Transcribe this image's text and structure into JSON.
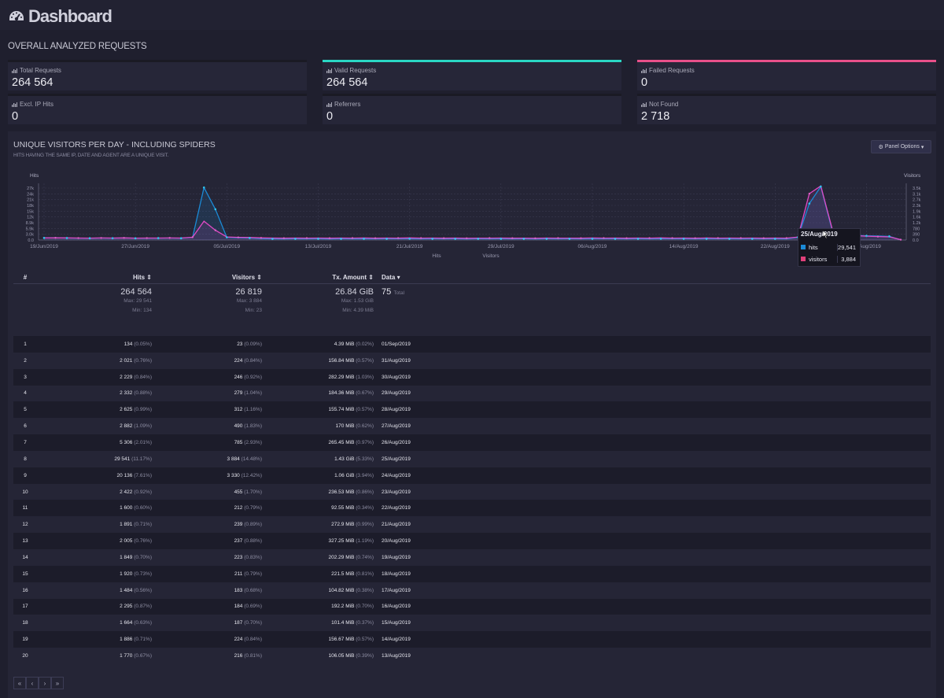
{
  "app": {
    "title": "Dashboard"
  },
  "overall": {
    "title": "OVERALL ANALYZED REQUESTS",
    "cards": [
      {
        "label": "Total Requests",
        "value": "264 564",
        "accent": "#1a1a24"
      },
      {
        "label": "Valid Requests",
        "value": "264 564",
        "accent": "#2ad7c4"
      },
      {
        "label": "Failed Requests",
        "value": "0",
        "accent": "#e8508a"
      },
      {
        "label": "Excl. IP Hits",
        "value": "0",
        "accent": "#1a1a24"
      },
      {
        "label": "Referrers",
        "value": "0",
        "accent": "#1a1a24"
      },
      {
        "label": "Not Found",
        "value": "2 718",
        "accent": "#1a1a24"
      }
    ]
  },
  "panel": {
    "title": "UNIQUE VISITORS PER DAY - INCLUDING SPIDERS",
    "subtitle": "HITS HAVING THE SAME IP, DATE AND AGENT ARE A UNIQUE VISIT.",
    "options_label": "Panel Options"
  },
  "chart_data": {
    "type": "area",
    "ylabel_left": "Hits",
    "ylabel_right": "Visitors",
    "y_ticks_left": [
      "27k",
      "24k",
      "21k",
      "18k",
      "15k",
      "12k",
      "8.9k",
      "5.9k",
      "3.0k",
      "0.0"
    ],
    "y_ticks_right": [
      "3.5k",
      "3.1k",
      "2.7k",
      "2.3k",
      "1.9k",
      "1.6k",
      "1.2k",
      "780",
      "390",
      "0.0"
    ],
    "x_ticks": [
      "19/Jun/2019",
      "27/Jun/2019",
      "05/Jul/2019",
      "13/Jul/2019",
      "21/Jul/2019",
      "29/Jul/2019",
      "06/Aug/2019",
      "14/Aug/2019",
      "22/Aug/2019",
      "30/Aug/2019"
    ],
    "legend": [
      "Hits",
      "Visitors"
    ],
    "colors": {
      "hits": "#1b8ad6",
      "visitors": "#e04ac4"
    },
    "series": [
      {
        "name": "Hits",
        "values": [
          1150,
          1200,
          1100,
          1050,
          1000,
          1080,
          1020,
          1120,
          980,
          1020,
          1050,
          1100,
          1000,
          1500,
          29000,
          17000,
          1500,
          1200,
          1100,
          800,
          650,
          600,
          700,
          650,
          700,
          620,
          700,
          650,
          720,
          640,
          700,
          680,
          760,
          650,
          700,
          640,
          700,
          620,
          680,
          660,
          700,
          640,
          680,
          600,
          700,
          660,
          680,
          640,
          720,
          680,
          700,
          640,
          700,
          660,
          760,
          680,
          700,
          650,
          720,
          680,
          700,
          660,
          700,
          640,
          700,
          650,
          1500,
          20136,
          29541,
          5306,
          2882,
          2625,
          2332,
          2229,
          2021,
          134
        ]
      },
      {
        "name": "Visitors",
        "values": [
          150,
          155,
          150,
          140,
          138,
          145,
          140,
          150,
          135,
          140,
          140,
          148,
          140,
          200,
          1350,
          700,
          220,
          190,
          180,
          150,
          140,
          130,
          140,
          135,
          140,
          128,
          140,
          135,
          145,
          130,
          140,
          138,
          150,
          135,
          140,
          128,
          140,
          125,
          138,
          135,
          140,
          130,
          138,
          122,
          140,
          135,
          138,
          130,
          145,
          138,
          140,
          130,
          140,
          135,
          150,
          138,
          140,
          132,
          145,
          138,
          140,
          135,
          140,
          130,
          140,
          135,
          211,
          3330,
          3884,
          785,
          490,
          312,
          279,
          246,
          224,
          23
        ]
      }
    ],
    "tooltip": {
      "date": "25/Aug/2019",
      "hits_label": "hits",
      "hits_value": "29,541",
      "visitors_label": "visitors",
      "visitors_value": "3,884"
    }
  },
  "table": {
    "headers": {
      "num": "#",
      "hits": "Hits",
      "visitors": "Visitors",
      "tx": "Tx. Amount",
      "data": "Data"
    },
    "summary": {
      "hits": "264 564",
      "hits_max": "Max: 29 541",
      "hits_min": "Min: 134",
      "visitors": "26 819",
      "visitors_max": "Max: 3 884",
      "visitors_min": "Min: 23",
      "tx": "26.84 GiB",
      "tx_max": "Max: 1.53 GiB",
      "tx_min": "Min: 4.39 MiB",
      "data": "75",
      "data_label": "Total"
    },
    "rows": [
      {
        "n": "1",
        "hits": "134",
        "hits_pct": "(0.05%)",
        "vis": "23",
        "vis_pct": "(0.09%)",
        "tx": "4.39 MiB",
        "tx_pct": "(0.02%)",
        "date": "01/Sep/2019"
      },
      {
        "n": "2",
        "hits": "2 021",
        "hits_pct": "(0.76%)",
        "vis": "224",
        "vis_pct": "(0.84%)",
        "tx": "156.84 MiB",
        "tx_pct": "(0.57%)",
        "date": "31/Aug/2019"
      },
      {
        "n": "3",
        "hits": "2 229",
        "hits_pct": "(0.84%)",
        "vis": "246",
        "vis_pct": "(0.92%)",
        "tx": "282.29 MiB",
        "tx_pct": "(1.03%)",
        "date": "30/Aug/2019"
      },
      {
        "n": "4",
        "hits": "2 332",
        "hits_pct": "(0.88%)",
        "vis": "279",
        "vis_pct": "(1.04%)",
        "tx": "184.36 MiB",
        "tx_pct": "(0.67%)",
        "date": "29/Aug/2019"
      },
      {
        "n": "5",
        "hits": "2 625",
        "hits_pct": "(0.99%)",
        "vis": "312",
        "vis_pct": "(1.16%)",
        "tx": "155.74 MiB",
        "tx_pct": "(0.57%)",
        "date": "28/Aug/2019"
      },
      {
        "n": "6",
        "hits": "2 882",
        "hits_pct": "(1.09%)",
        "vis": "490",
        "vis_pct": "(1.83%)",
        "tx": "170 MiB",
        "tx_pct": "(0.62%)",
        "date": "27/Aug/2019"
      },
      {
        "n": "7",
        "hits": "5 306",
        "hits_pct": "(2.01%)",
        "vis": "785",
        "vis_pct": "(2.93%)",
        "tx": "265.45 MiB",
        "tx_pct": "(0.97%)",
        "date": "26/Aug/2019"
      },
      {
        "n": "8",
        "hits": "29 541",
        "hits_pct": "(11.17%)",
        "vis": "3 884",
        "vis_pct": "(14.48%)",
        "tx": "1.43 GiB",
        "tx_pct": "(5.33%)",
        "date": "25/Aug/2019"
      },
      {
        "n": "9",
        "hits": "20 136",
        "hits_pct": "(7.61%)",
        "vis": "3 330",
        "vis_pct": "(12.42%)",
        "tx": "1.06 GiB",
        "tx_pct": "(3.94%)",
        "date": "24/Aug/2019"
      },
      {
        "n": "10",
        "hits": "2 422",
        "hits_pct": "(0.92%)",
        "vis": "455",
        "vis_pct": "(1.70%)",
        "tx": "236.53 MiB",
        "tx_pct": "(0.86%)",
        "date": "23/Aug/2019"
      },
      {
        "n": "11",
        "hits": "1 600",
        "hits_pct": "(0.60%)",
        "vis": "212",
        "vis_pct": "(0.79%)",
        "tx": "92.55 MiB",
        "tx_pct": "(0.34%)",
        "date": "22/Aug/2019"
      },
      {
        "n": "12",
        "hits": "1 891",
        "hits_pct": "(0.71%)",
        "vis": "239",
        "vis_pct": "(0.89%)",
        "tx": "272.9 MiB",
        "tx_pct": "(0.99%)",
        "date": "21/Aug/2019"
      },
      {
        "n": "13",
        "hits": "2 005",
        "hits_pct": "(0.76%)",
        "vis": "237",
        "vis_pct": "(0.88%)",
        "tx": "327.25 MiB",
        "tx_pct": "(1.19%)",
        "date": "20/Aug/2019"
      },
      {
        "n": "14",
        "hits": "1 849",
        "hits_pct": "(0.70%)",
        "vis": "223",
        "vis_pct": "(0.83%)",
        "tx": "202.29 MiB",
        "tx_pct": "(0.74%)",
        "date": "19/Aug/2019"
      },
      {
        "n": "15",
        "hits": "1 920",
        "hits_pct": "(0.73%)",
        "vis": "211",
        "vis_pct": "(0.79%)",
        "tx": "221.5 MiB",
        "tx_pct": "(0.81%)",
        "date": "18/Aug/2019"
      },
      {
        "n": "16",
        "hits": "1 484",
        "hits_pct": "(0.56%)",
        "vis": "183",
        "vis_pct": "(0.68%)",
        "tx": "104.82 MiB",
        "tx_pct": "(0.38%)",
        "date": "17/Aug/2019"
      },
      {
        "n": "17",
        "hits": "2 295",
        "hits_pct": "(0.87%)",
        "vis": "184",
        "vis_pct": "(0.69%)",
        "tx": "192.2 MiB",
        "tx_pct": "(0.70%)",
        "date": "16/Aug/2019"
      },
      {
        "n": "18",
        "hits": "1 664",
        "hits_pct": "(0.63%)",
        "vis": "187",
        "vis_pct": "(0.70%)",
        "tx": "101.4 MiB",
        "tx_pct": "(0.37%)",
        "date": "15/Aug/2019"
      },
      {
        "n": "19",
        "hits": "1 886",
        "hits_pct": "(0.71%)",
        "vis": "224",
        "vis_pct": "(0.84%)",
        "tx": "156.67 MiB",
        "tx_pct": "(0.57%)",
        "date": "14/Aug/2019"
      },
      {
        "n": "20",
        "hits": "1 770",
        "hits_pct": "(0.67%)",
        "vis": "216",
        "vis_pct": "(0.81%)",
        "tx": "106.05 MiB",
        "tx_pct": "(0.39%)",
        "date": "13/Aug/2019"
      }
    ]
  },
  "pager": {
    "first": "«",
    "prev": "‹",
    "next": "›",
    "last": "»"
  }
}
